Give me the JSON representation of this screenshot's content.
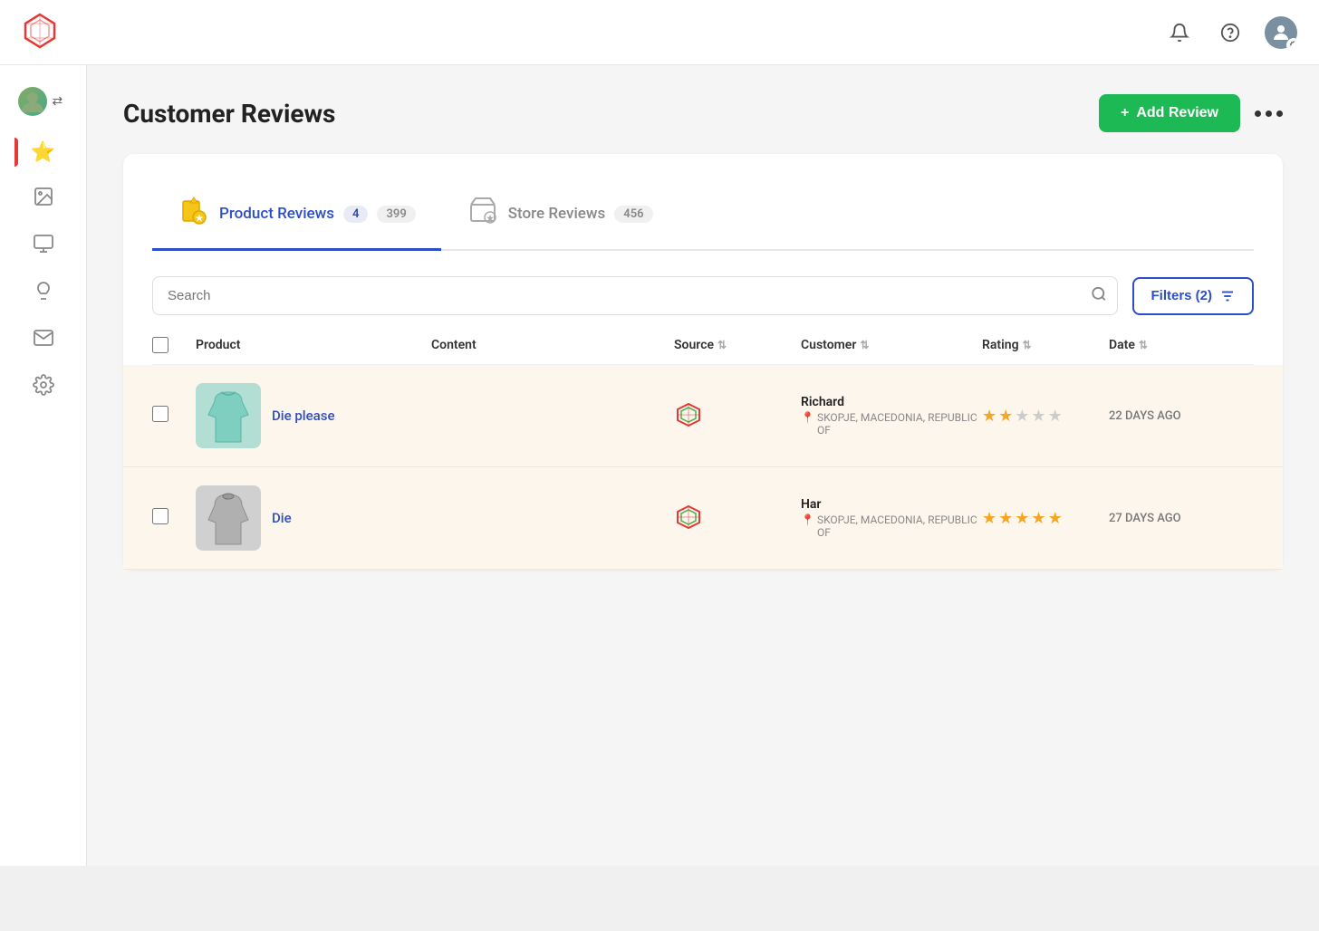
{
  "topNav": {
    "logoAlt": "App Logo"
  },
  "pageHeader": {
    "title": "Customer Reviews",
    "addButtonLabel": "Add Review",
    "addButtonIcon": "+"
  },
  "sidebar": {
    "items": [
      {
        "icon": "⭐",
        "name": "reviews",
        "active": true
      },
      {
        "icon": "🖼",
        "name": "media"
      },
      {
        "icon": "🖥",
        "name": "display"
      },
      {
        "icon": "💡",
        "name": "ideas"
      },
      {
        "icon": "✉",
        "name": "mail"
      },
      {
        "icon": "⚙",
        "name": "settings"
      }
    ]
  },
  "tabs": [
    {
      "label": "Product Reviews",
      "badge": "4",
      "badge2": "399",
      "active": true
    },
    {
      "label": "Store Reviews",
      "badge": "456",
      "active": false
    }
  ],
  "search": {
    "placeholder": "Search",
    "filtersLabel": "Filters (2)"
  },
  "tableHeaders": [
    {
      "label": "",
      "sortable": false
    },
    {
      "label": "Product",
      "sortable": false
    },
    {
      "label": "Content",
      "sortable": false
    },
    {
      "label": "Source",
      "sortable": true
    },
    {
      "label": "Customer",
      "sortable": true
    },
    {
      "label": "Rating",
      "sortable": true
    },
    {
      "label": "Date",
      "sortable": true
    }
  ],
  "rows": [
    {
      "id": "row1",
      "productName": "Die please",
      "productImgBg": "#b2e0c8",
      "productImgType": "green-sweater",
      "content": "",
      "customer": {
        "name": "Richard",
        "location": "SKOPJE, MACEDONIA, REPUBLIC OF"
      },
      "rating": 2,
      "totalStars": 5,
      "date": "22 DAYS AGO"
    },
    {
      "id": "row2",
      "productName": "Die",
      "productImgBg": "#c8c8c8",
      "productImgType": "gray-sweater",
      "content": "",
      "customer": {
        "name": "Har",
        "location": "SKOPJE, MACEDONIA, REPUBLIC OF"
      },
      "rating": 4.5,
      "totalStars": 5,
      "date": "27 DAYS AGO"
    }
  ],
  "colors": {
    "accent": "#2d4ec7",
    "addBtn": "#1db954",
    "starFilled": "#f5a623",
    "rowBg": "#fdf6ed"
  }
}
